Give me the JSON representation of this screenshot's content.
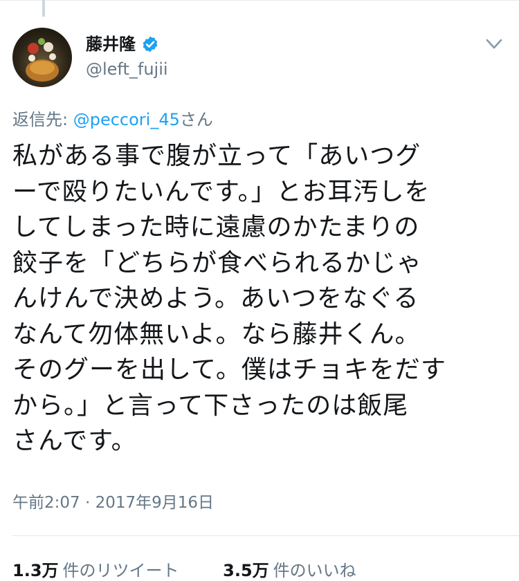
{
  "user": {
    "display_name": "藤井隆",
    "handle": "@left_fujii",
    "verified": true,
    "avatar_icon": "profile-photo"
  },
  "reply": {
    "prefix": "返信先: ",
    "mention": "@peccori_45",
    "suffix": "さん"
  },
  "tweet": {
    "lines": [
      "私がある事で腹が立って「あいつグ",
      "ーで殴りたいんです。」とお耳汚しを",
      "してしまった時に遠慮のかたまりの",
      "餃子を「どちらが食べられるかじゃ",
      "んけんで決めよう。あいつをなぐる",
      "なんて勿体無いよ。なら藤井くん。",
      "そのグーを出して。僕はチョキをだす",
      "から。」と言って下さったのは飯尾",
      "さんです。"
    ]
  },
  "timestamp": "午前2:07 · 2017年9月16日",
  "stats": {
    "retweets_count": "1.3万",
    "retweets_label": "件のリツイート",
    "likes_count": "3.5万",
    "likes_label": "件のいいね"
  },
  "colors": {
    "accent": "#1da1f2",
    "secondary_text": "#657786",
    "primary_text": "#14171a"
  },
  "icons": {
    "menu": "chevron-down-icon",
    "verified": "verified-badge-icon"
  }
}
